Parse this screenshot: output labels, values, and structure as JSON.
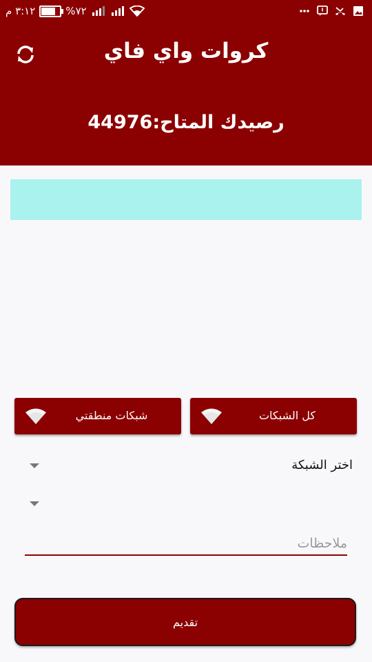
{
  "status_bar": {
    "time": "٣:١٢ م",
    "battery": "%٧٢",
    "battery_level": 0.72,
    "signal_icons": [
      "signal-sim1-icon",
      "signal-sim2-icon",
      "wifi-icon"
    ],
    "notification_icons": [
      "image-icon",
      "missed-call-icon",
      "message-icon",
      "more-dots-icon"
    ]
  },
  "header": {
    "title": "كروات واي فاي",
    "balance_text": "رصيدك المتاح:44976",
    "refresh_icon": "refresh-icon"
  },
  "colors": {
    "primary": "#8b0000",
    "banner": "#aaf2ee",
    "background": "#f8f8fa"
  },
  "buttons": {
    "all_networks": "كل الشبكات",
    "my_networks": "شبكات منطقتي",
    "icon": "wifi-icon"
  },
  "form": {
    "network_label": "اختر الشبكة",
    "notes_placeholder": "ملاحظات",
    "notes_value": "",
    "submit_label": "تقديم"
  }
}
